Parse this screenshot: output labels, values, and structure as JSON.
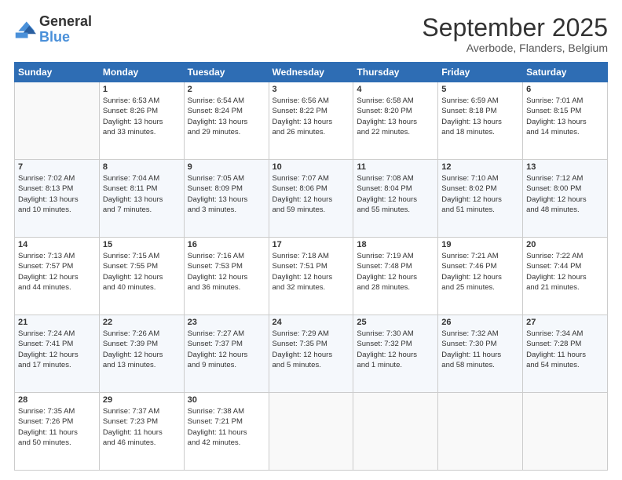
{
  "logo": {
    "line1": "General",
    "line2": "Blue"
  },
  "title": "September 2025",
  "subtitle": "Averbode, Flanders, Belgium",
  "days_header": [
    "Sunday",
    "Monday",
    "Tuesday",
    "Wednesday",
    "Thursday",
    "Friday",
    "Saturday"
  ],
  "weeks": [
    [
      {
        "num": "",
        "content": ""
      },
      {
        "num": "1",
        "content": "Sunrise: 6:53 AM\nSunset: 8:26 PM\nDaylight: 13 hours\nand 33 minutes."
      },
      {
        "num": "2",
        "content": "Sunrise: 6:54 AM\nSunset: 8:24 PM\nDaylight: 13 hours\nand 29 minutes."
      },
      {
        "num": "3",
        "content": "Sunrise: 6:56 AM\nSunset: 8:22 PM\nDaylight: 13 hours\nand 26 minutes."
      },
      {
        "num": "4",
        "content": "Sunrise: 6:58 AM\nSunset: 8:20 PM\nDaylight: 13 hours\nand 22 minutes."
      },
      {
        "num": "5",
        "content": "Sunrise: 6:59 AM\nSunset: 8:18 PM\nDaylight: 13 hours\nand 18 minutes."
      },
      {
        "num": "6",
        "content": "Sunrise: 7:01 AM\nSunset: 8:15 PM\nDaylight: 13 hours\nand 14 minutes."
      }
    ],
    [
      {
        "num": "7",
        "content": "Sunrise: 7:02 AM\nSunset: 8:13 PM\nDaylight: 13 hours\nand 10 minutes."
      },
      {
        "num": "8",
        "content": "Sunrise: 7:04 AM\nSunset: 8:11 PM\nDaylight: 13 hours\nand 7 minutes."
      },
      {
        "num": "9",
        "content": "Sunrise: 7:05 AM\nSunset: 8:09 PM\nDaylight: 13 hours\nand 3 minutes."
      },
      {
        "num": "10",
        "content": "Sunrise: 7:07 AM\nSunset: 8:06 PM\nDaylight: 12 hours\nand 59 minutes."
      },
      {
        "num": "11",
        "content": "Sunrise: 7:08 AM\nSunset: 8:04 PM\nDaylight: 12 hours\nand 55 minutes."
      },
      {
        "num": "12",
        "content": "Sunrise: 7:10 AM\nSunset: 8:02 PM\nDaylight: 12 hours\nand 51 minutes."
      },
      {
        "num": "13",
        "content": "Sunrise: 7:12 AM\nSunset: 8:00 PM\nDaylight: 12 hours\nand 48 minutes."
      }
    ],
    [
      {
        "num": "14",
        "content": "Sunrise: 7:13 AM\nSunset: 7:57 PM\nDaylight: 12 hours\nand 44 minutes."
      },
      {
        "num": "15",
        "content": "Sunrise: 7:15 AM\nSunset: 7:55 PM\nDaylight: 12 hours\nand 40 minutes."
      },
      {
        "num": "16",
        "content": "Sunrise: 7:16 AM\nSunset: 7:53 PM\nDaylight: 12 hours\nand 36 minutes."
      },
      {
        "num": "17",
        "content": "Sunrise: 7:18 AM\nSunset: 7:51 PM\nDaylight: 12 hours\nand 32 minutes."
      },
      {
        "num": "18",
        "content": "Sunrise: 7:19 AM\nSunset: 7:48 PM\nDaylight: 12 hours\nand 28 minutes."
      },
      {
        "num": "19",
        "content": "Sunrise: 7:21 AM\nSunset: 7:46 PM\nDaylight: 12 hours\nand 25 minutes."
      },
      {
        "num": "20",
        "content": "Sunrise: 7:22 AM\nSunset: 7:44 PM\nDaylight: 12 hours\nand 21 minutes."
      }
    ],
    [
      {
        "num": "21",
        "content": "Sunrise: 7:24 AM\nSunset: 7:41 PM\nDaylight: 12 hours\nand 17 minutes."
      },
      {
        "num": "22",
        "content": "Sunrise: 7:26 AM\nSunset: 7:39 PM\nDaylight: 12 hours\nand 13 minutes."
      },
      {
        "num": "23",
        "content": "Sunrise: 7:27 AM\nSunset: 7:37 PM\nDaylight: 12 hours\nand 9 minutes."
      },
      {
        "num": "24",
        "content": "Sunrise: 7:29 AM\nSunset: 7:35 PM\nDaylight: 12 hours\nand 5 minutes."
      },
      {
        "num": "25",
        "content": "Sunrise: 7:30 AM\nSunset: 7:32 PM\nDaylight: 12 hours\nand 1 minute."
      },
      {
        "num": "26",
        "content": "Sunrise: 7:32 AM\nSunset: 7:30 PM\nDaylight: 11 hours\nand 58 minutes."
      },
      {
        "num": "27",
        "content": "Sunrise: 7:34 AM\nSunset: 7:28 PM\nDaylight: 11 hours\nand 54 minutes."
      }
    ],
    [
      {
        "num": "28",
        "content": "Sunrise: 7:35 AM\nSunset: 7:26 PM\nDaylight: 11 hours\nand 50 minutes."
      },
      {
        "num": "29",
        "content": "Sunrise: 7:37 AM\nSunset: 7:23 PM\nDaylight: 11 hours\nand 46 minutes."
      },
      {
        "num": "30",
        "content": "Sunrise: 7:38 AM\nSunset: 7:21 PM\nDaylight: 11 hours\nand 42 minutes."
      },
      {
        "num": "",
        "content": ""
      },
      {
        "num": "",
        "content": ""
      },
      {
        "num": "",
        "content": ""
      },
      {
        "num": "",
        "content": ""
      }
    ]
  ]
}
